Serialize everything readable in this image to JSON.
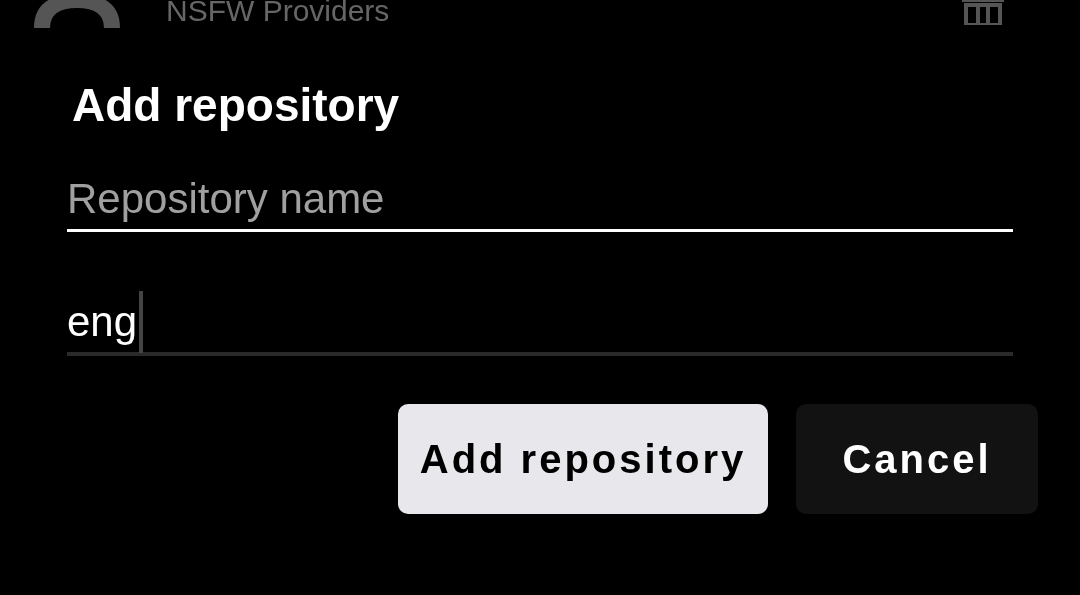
{
  "background_item": {
    "title": "NSFW Providers"
  },
  "dialog": {
    "title": "Add repository",
    "fields": [
      {
        "placeholder": "Repository name"
      },
      {
        "value": "eng"
      }
    ],
    "buttons": [
      {
        "label": "Add repository",
        "kind": "primary"
      },
      {
        "label": "Cancel",
        "kind": "secondary"
      }
    ]
  }
}
